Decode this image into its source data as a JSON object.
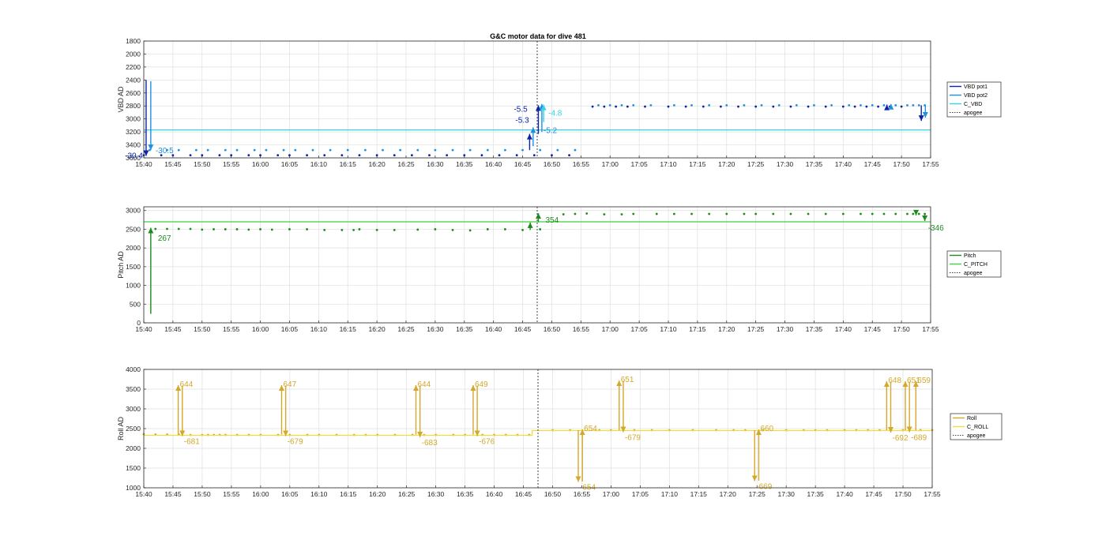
{
  "figure": {
    "title": "G&C motor data for dive 481"
  },
  "time_ticks": [
    "15:40",
    "15:45",
    "15:50",
    "15:55",
    "16:00",
    "16:05",
    "16:10",
    "16:15",
    "16:20",
    "16:25",
    "16:30",
    "16:35",
    "16:40",
    "16:45",
    "16:50",
    "16:55",
    "17:00",
    "17:05",
    "17:10",
    "17:15",
    "17:20",
    "17:25",
    "17:30",
    "17:35",
    "17:40",
    "17:45",
    "17:50",
    "17:55"
  ],
  "colors": {
    "vbd_pot1": "#0b23a8",
    "vbd_pot2": "#1f8fe0",
    "c_vbd": "#2fd4e6",
    "pitch": "#1e8a1e",
    "c_pitch": "#3fd13f",
    "roll": "#d4a82a",
    "c_roll": "#f0dc40",
    "apogee": "#444444"
  },
  "chart_data": [
    {
      "id": "vbd",
      "type": "line",
      "ylabel": "VBD AD",
      "ylim": [
        1800,
        3600
      ],
      "y_reversed": true,
      "yticks": [
        1800,
        2000,
        2200,
        2400,
        2600,
        2800,
        3000,
        3200,
        3400,
        3600
      ],
      "xlim": [
        0,
        135
      ],
      "grid": true,
      "legend": {
        "placement": "outside-right",
        "entries": [
          "VBD pot1",
          "VBD pot2",
          "C_VBD",
          "apogee"
        ]
      },
      "series": [
        {
          "name": "VBD pot1",
          "marker": "dot",
          "x": [
            0,
            3,
            5,
            8,
            10,
            13,
            15,
            18,
            20,
            23,
            25,
            28,
            31,
            34,
            37,
            40,
            43,
            46,
            49,
            52,
            55,
            58,
            61,
            64,
            67,
            70,
            73,
            77,
            79,
            81,
            83,
            86,
            90,
            93,
            96,
            99,
            102,
            105,
            108,
            111,
            114,
            117,
            120,
            122,
            124,
            126,
            128,
            130
          ],
          "y": [
            3560,
            3560,
            3560,
            3560,
            3560,
            3560,
            3560,
            3560,
            3560,
            3560,
            3560,
            3560,
            3560,
            3560,
            3560,
            3560,
            3560,
            3560,
            3560,
            3560,
            3560,
            3560,
            3560,
            3560,
            3560,
            3560,
            3560,
            2810,
            2810,
            2810,
            2810,
            2810,
            2810,
            2810,
            2810,
            2810,
            2810,
            2810,
            2810,
            2810,
            2810,
            2810,
            2810,
            2810,
            2810,
            2810,
            2810,
            2810
          ]
        },
        {
          "name": "VBD pot2",
          "marker": "dot",
          "x": [
            1,
            4,
            6,
            9,
            11,
            14,
            16,
            19,
            21,
            24,
            26,
            29,
            32,
            35,
            38,
            41,
            44,
            47,
            50,
            53,
            56,
            59,
            62,
            65,
            68,
            71,
            74,
            78,
            80,
            82,
            84,
            87,
            91,
            94,
            97,
            100,
            103,
            106,
            109,
            112,
            115,
            118,
            121,
            123,
            125,
            127,
            129,
            131,
            132,
            133,
            134
          ],
          "y": [
            3480,
            3480,
            3480,
            3480,
            3480,
            3480,
            3480,
            3480,
            3480,
            3480,
            3480,
            3480,
            3480,
            3480,
            3480,
            3480,
            3480,
            3480,
            3480,
            3480,
            3480,
            3480,
            3480,
            3480,
            3480,
            3480,
            3480,
            2790,
            2790,
            2790,
            2790,
            2790,
            2790,
            2790,
            2790,
            2790,
            2790,
            2790,
            2790,
            2790,
            2790,
            2790,
            2790,
            2790,
            2790,
            2790,
            2790,
            2790,
            2790,
            2790,
            2790
          ]
        },
        {
          "name": "C_VBD",
          "marker": "none",
          "x": [
            0,
            135
          ],
          "y": [
            3170,
            3170
          ]
        }
      ],
      "arrows": [
        {
          "x": 0.4,
          "y0": 2400,
          "y1": 3570,
          "series": "VBD pot1",
          "label": "-30.4"
        },
        {
          "x": 1.2,
          "y0": 2420,
          "y1": 3480,
          "series": "VBD pot2",
          "label": "-30.5"
        },
        {
          "x": 66.2,
          "y0": 3480,
          "y1": 3230,
          "series": "VBD pot1",
          "label": "-5.3"
        },
        {
          "x": 66.8,
          "y0": 3420,
          "y1": 3130,
          "series": "VBD pot2",
          "label": ""
        },
        {
          "x": 67.7,
          "y0": 3230,
          "y1": 2790,
          "series": "VBD pot1",
          "label": "-5.5"
        },
        {
          "x": 68.3,
          "y0": 3200,
          "y1": 2770,
          "series": "VBD pot2",
          "label": "-5.2"
        },
        {
          "x": 68.6,
          "y0": 3050,
          "y1": 2780,
          "series": "C_VBD",
          "label": "-4.8"
        },
        {
          "x": 127.5,
          "y0": 2810,
          "y1": 2780,
          "series": "VBD pot1",
          "label": ""
        },
        {
          "x": 128.2,
          "y0": 2800,
          "y1": 2770,
          "series": "VBD pot2",
          "label": ""
        },
        {
          "x": 133.4,
          "y0": 2790,
          "y1": 3030,
          "series": "VBD pot1",
          "label": ""
        },
        {
          "x": 134.1,
          "y0": 2790,
          "y1": 2980,
          "series": "VBD pot2",
          "label": ""
        }
      ],
      "apogee_x": 67.5
    },
    {
      "id": "pitch",
      "type": "line",
      "ylabel": "Pitch AD",
      "ylim": [
        0,
        3100
      ],
      "yticks": [
        0,
        500,
        1000,
        1500,
        2000,
        2500,
        3000
      ],
      "xlim": [
        0,
        135
      ],
      "grid": true,
      "legend": {
        "placement": "outside-right",
        "entries": [
          "Pitch",
          "C_PITCH",
          "apogee"
        ]
      },
      "series": [
        {
          "name": "Pitch",
          "marker": "dot",
          "x": [
            2,
            4,
            6,
            8,
            10,
            12,
            14,
            16,
            18,
            20,
            22,
            25,
            28,
            31,
            34,
            36,
            37,
            40,
            43,
            47,
            50,
            53,
            56,
            59,
            62,
            65,
            68,
            72,
            74,
            76,
            79,
            82,
            84,
            88,
            91,
            94,
            97,
            100,
            103,
            105,
            108,
            111,
            114,
            117,
            120,
            123,
            125,
            127,
            129,
            131,
            132,
            133,
            134
          ],
          "y": [
            2510,
            2510,
            2510,
            2510,
            2490,
            2500,
            2500,
            2500,
            2490,
            2500,
            2490,
            2500,
            2500,
            2480,
            2480,
            2480,
            2500,
            2480,
            2480,
            2490,
            2500,
            2480,
            2470,
            2500,
            2500,
            2480,
            2500,
            2900,
            2910,
            2920,
            2900,
            2900,
            2910,
            2910,
            2910,
            2910,
            2910,
            2910,
            2910,
            2910,
            2910,
            2910,
            2910,
            2910,
            2910,
            2910,
            2910,
            2910,
            2910,
            2910,
            2910,
            2910,
            2910
          ]
        },
        {
          "name": "C_PITCH",
          "marker": "none",
          "x": [
            0,
            135
          ],
          "y": [
            2700,
            2700
          ]
        }
      ],
      "arrows": [
        {
          "x": 1.2,
          "y0": 240,
          "y1": 2540,
          "series": "Pitch",
          "label": "267"
        },
        {
          "x": 66.3,
          "y0": 2480,
          "y1": 2680,
          "series": "Pitch",
          "label": ""
        },
        {
          "x": 67.7,
          "y0": 2690,
          "y1": 2930,
          "series": "Pitch",
          "label": "354"
        },
        {
          "x": 132.5,
          "y0": 2950,
          "y1": 2870,
          "series": "Pitch",
          "label": ""
        },
        {
          "x": 134.0,
          "y0": 2880,
          "y1": 2720,
          "series": "Pitch",
          "label": "-346"
        }
      ],
      "apogee_x": 67.5
    },
    {
      "id": "roll",
      "type": "line",
      "ylabel": "Roll AD",
      "ylim": [
        1000,
        4000
      ],
      "yticks": [
        1000,
        1500,
        2000,
        2500,
        3000,
        3500,
        4000
      ],
      "xlim": [
        0,
        135
      ],
      "grid": true,
      "legend": {
        "placement": "outside-right",
        "entries": [
          "Roll",
          "C_ROLL",
          "apogee"
        ]
      },
      "series": [
        {
          "name": "Roll",
          "marker": "dot",
          "x": [
            0,
            2,
            4,
            6,
            8,
            10,
            11,
            12,
            13,
            14,
            16,
            18,
            20,
            23,
            25,
            28,
            30,
            33,
            36,
            38,
            40,
            43,
            46,
            48,
            50,
            53,
            55,
            58,
            60,
            62,
            64,
            66,
            70,
            73,
            78,
            80,
            84,
            87,
            90,
            94,
            98,
            101,
            103,
            106,
            110,
            113,
            115,
            117,
            120,
            122,
            124,
            126,
            128,
            130,
            133,
            135
          ],
          "y": [
            2360,
            2350,
            2350,
            2350,
            2340,
            2340,
            2340,
            2340,
            2340,
            2340,
            2340,
            2340,
            2340,
            2340,
            2340,
            2340,
            2340,
            2340,
            2340,
            2340,
            2340,
            2340,
            2340,
            2340,
            2340,
            2340,
            2340,
            2340,
            2340,
            2340,
            2340,
            2340,
            2460,
            2460,
            2460,
            2460,
            2460,
            2460,
            2460,
            2460,
            2460,
            2460,
            2460,
            2460,
            2460,
            2460,
            2460,
            2460,
            2460,
            2460,
            2460,
            2460,
            2460,
            2460,
            2460,
            2460
          ]
        },
        {
          "name": "C_ROLL",
          "marker": "none",
          "x": [
            0,
            66.5,
            66.5,
            135
          ],
          "y": [
            2330,
            2330,
            2450,
            2450
          ]
        }
      ],
      "arrows": [
        {
          "x": 5.9,
          "y0": 2350,
          "y1": 3600,
          "series": "Roll",
          "label": "644"
        },
        {
          "x": 6.6,
          "y0": 3590,
          "y1": 2310,
          "series": "Roll",
          "label": "-681"
        },
        {
          "x": 23.6,
          "y0": 2350,
          "y1": 3600,
          "series": "Roll",
          "label": "647"
        },
        {
          "x": 24.3,
          "y0": 3590,
          "y1": 2310,
          "series": "Roll",
          "label": "-679"
        },
        {
          "x": 46.6,
          "y0": 2350,
          "y1": 3600,
          "series": "Roll",
          "label": "644"
        },
        {
          "x": 47.3,
          "y0": 3590,
          "y1": 2280,
          "series": "Roll",
          "label": "-683"
        },
        {
          "x": 56.4,
          "y0": 2350,
          "y1": 3600,
          "series": "Roll",
          "label": "649"
        },
        {
          "x": 57.1,
          "y0": 3590,
          "y1": 2310,
          "series": "Roll",
          "label": "-676"
        },
        {
          "x": 74.4,
          "y0": 2460,
          "y1": 1150,
          "series": "Roll",
          "label": "-654"
        },
        {
          "x": 75.1,
          "y0": 1160,
          "y1": 2480,
          "series": "Roll",
          "label": "654"
        },
        {
          "x": 81.4,
          "y0": 2460,
          "y1": 3720,
          "series": "Roll",
          "label": "651"
        },
        {
          "x": 82.1,
          "y0": 3710,
          "y1": 2410,
          "series": "Roll",
          "label": "-679"
        },
        {
          "x": 104.6,
          "y0": 2460,
          "y1": 1170,
          "series": "Roll",
          "label": "-669"
        },
        {
          "x": 105.3,
          "y0": 1180,
          "y1": 2480,
          "series": "Roll",
          "label": "660"
        },
        {
          "x": 127.2,
          "y0": 2460,
          "y1": 3700,
          "series": "Roll",
          "label": "648"
        },
        {
          "x": 127.9,
          "y0": 3690,
          "y1": 2400,
          "series": "Roll",
          "label": "-692"
        },
        {
          "x": 130.4,
          "y0": 2460,
          "y1": 3700,
          "series": "Roll",
          "label": "651"
        },
        {
          "x": 131.1,
          "y0": 3690,
          "y1": 2410,
          "series": "Roll",
          "label": "-689"
        },
        {
          "x": 132.2,
          "y0": 2460,
          "y1": 3700,
          "series": "Roll",
          "label": "659"
        }
      ],
      "apogee_x": 67.5
    }
  ]
}
